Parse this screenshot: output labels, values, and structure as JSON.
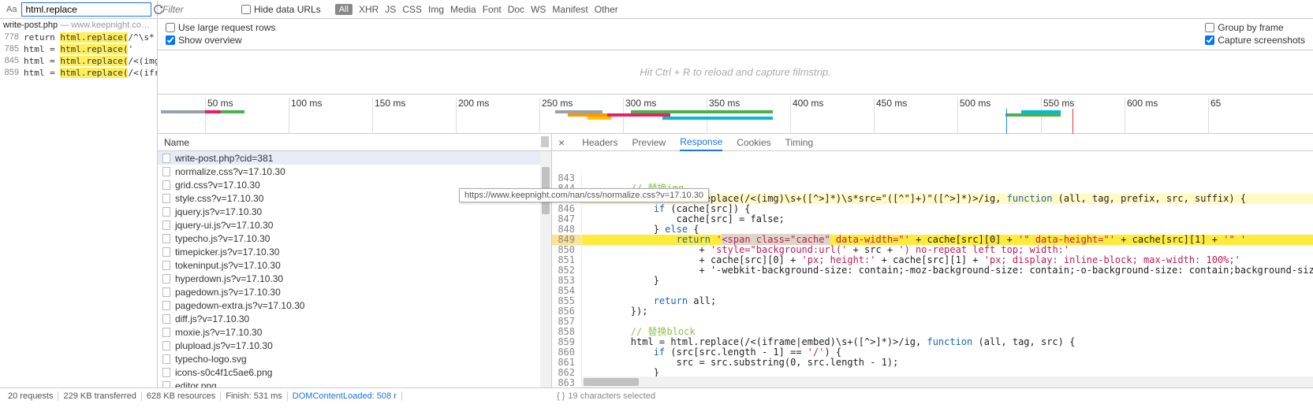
{
  "search": {
    "value": "html.replace",
    "case_icon": "Aa"
  },
  "filter": {
    "placeholder": "Filter",
    "hide_data_urls": "Hide data URLs"
  },
  "type_filters": {
    "all": "All",
    "items": [
      "XHR",
      "JS",
      "CSS",
      "Img",
      "Media",
      "Font",
      "Doc",
      "WS",
      "Manifest",
      "Other"
    ]
  },
  "options": {
    "large_rows": "Use large request rows",
    "overview": "Show overview",
    "group": "Group by frame",
    "capture": "Capture screenshots"
  },
  "filmstrip_hint": "Hit Ctrl + R to reload and capture filmstrip.",
  "search_results": {
    "source_file": "write-post.php",
    "source_loc": "— www.keepnight.co…",
    "lines": [
      {
        "n": "778",
        "pre": "return ",
        "hl": "html.replace(",
        "post": "/^\\s*<!-\\-\\s…"
      },
      {
        "n": "785",
        "pre": "html = ",
        "hl": "html.replace(",
        "post": "'<p><!--mor…"
      },
      {
        "n": "845",
        "pre": "html = ",
        "hl": "html.replace(",
        "post": "/<(img)\\s+([…"
      },
      {
        "n": "859",
        "pre": "html = ",
        "hl": "html.replace(",
        "post": "/<(iframe|e…"
      }
    ]
  },
  "timeline_ticks": [
    "50 ms",
    "100 ms",
    "150 ms",
    "200 ms",
    "250 ms",
    "300 ms",
    "350 ms",
    "400 ms",
    "450 ms",
    "500 ms",
    "550 ms",
    "600 ms",
    "65"
  ],
  "name_header": "Name",
  "requests": [
    "write-post.php?cid=381",
    "normalize.css?v=17.10.30",
    "grid.css?v=17.10.30",
    "style.css?v=17.10.30",
    "jquery.js?v=17.10.30",
    "jquery-ui.js?v=17.10.30",
    "typecho.js?v=17.10.30",
    "timepicker.js?v=17.10.30",
    "tokeninput.js?v=17.10.30",
    "hyperdown.js?v=17.10.30",
    "pagedown.js?v=17.10.30",
    "pagedown-extra.js?v=17.10.30",
    "diff.js?v=17.10.30",
    "moxie.js?v=17.10.30",
    "plupload.js?v=17.10.30",
    "typecho-logo.svg",
    "icons-s0c4f1c5ae6.png",
    "editor.png"
  ],
  "tooltip": "https://www.keepnight.com/nan/css/normalize.css?v=17.10.30",
  "detail_tabs": [
    "Headers",
    "Preview",
    "Response",
    "Cookies",
    "Timing"
  ],
  "code": {
    "start": 843,
    "lines": [
      "",
      "        // 替换img",
      "        html = html.replace(/<(img)\\s+([^>]*)\\s*src=\"([^\"]+)\"([^>]*)>/ig, function (all, tag, prefix, src, suffix) {",
      "            if (cache[src]) {",
      "                cache[src] = false;",
      "            } else {",
      "                return '<span class=\"cache\" data-width=\"' + cache[src][0] + '\" data-height=\"' + cache[src][1] + '\" '",
      "                    + 'style=\"background:url(' + src + ') no-repeat left top; width:'",
      "                    + cache[src][0] + 'px; height:' + cache[src][1] + 'px; display: inline-block; max-width: 100%;'",
      "                    + '-webkit-background-size: contain;-moz-background-size: contain;-o-background-size: contain;background-size: co",
      "            }",
      "",
      "            return all;",
      "        });",
      "",
      "        // 替换block",
      "        html = html.replace(/<(iframe|embed)\\s+([^>]*)>/ig, function (all, tag, src) {",
      "            if (src[src.length - 1] == '/') {",
      "                src = src.substring(0, src.length - 1);",
      "            }",
      ""
    ]
  },
  "status": {
    "requests": "20 requests",
    "transferred": "229 KB transferred",
    "resources": "628 KB resources",
    "finish": "Finish: 531 ms",
    "domcontent": "DOMContentLoaded: 508 r",
    "selection": "19 characters selected"
  }
}
